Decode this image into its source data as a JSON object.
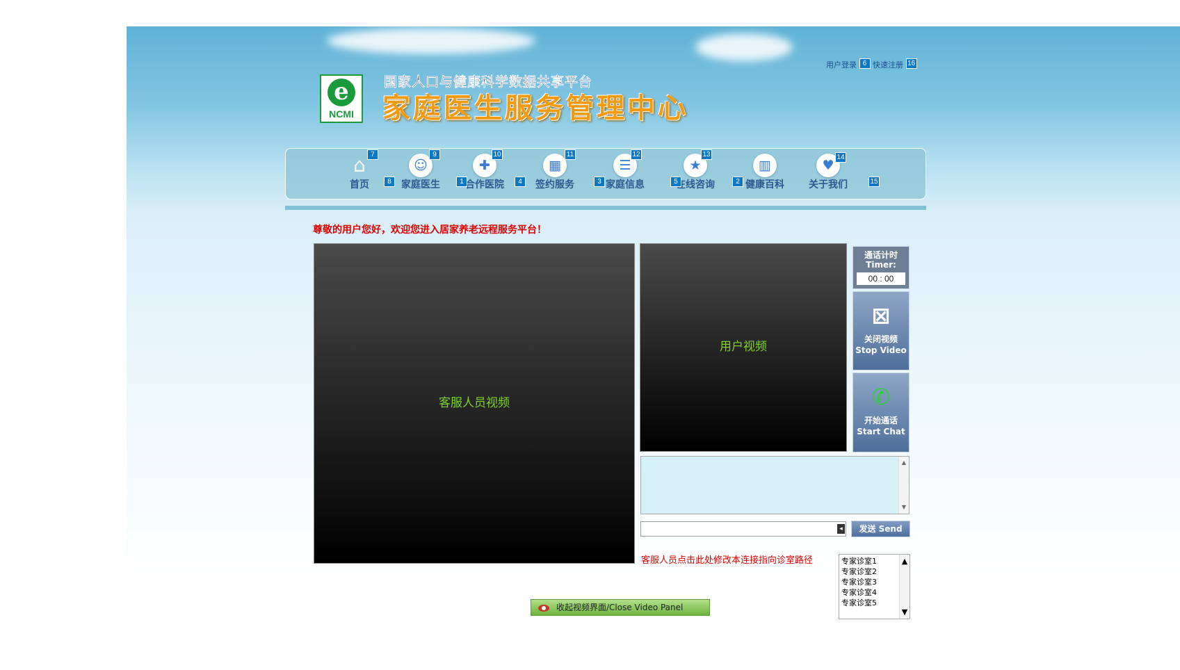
{
  "header": {
    "logo_text": "NCMI",
    "subtitle": "国家人口与健康科学数据共享平台",
    "title": "家庭医生服务管理中心",
    "login_link": "用户登录",
    "login_badge": "6",
    "register_link": "快速注册",
    "register_badge": "16"
  },
  "nav": {
    "items": [
      {
        "label": "首页",
        "icon": "home-icon",
        "badge": "7"
      },
      {
        "label": "家庭医生",
        "icon": "doctor-icon",
        "badge": "9"
      },
      {
        "label": "合作医院",
        "icon": "hospital-icon",
        "badge": "10"
      },
      {
        "label": "签约服务",
        "icon": "calendar-icon",
        "badge": "11"
      },
      {
        "label": "家庭信息",
        "icon": "family-info-icon",
        "badge": "12"
      },
      {
        "label": "在线咨询",
        "icon": "star-hand-icon",
        "badge": "13"
      },
      {
        "label": "健康百科",
        "icon": "book-icon",
        "badge": "2"
      },
      {
        "label": "关于我们",
        "icon": "handshake-icon",
        "badge": "14"
      }
    ],
    "inline_badges": [
      "8",
      "1",
      "4",
      "3",
      "5",
      "15"
    ]
  },
  "greeting": "尊敬的用户您好，欢迎您进入居家养老远程服务平台！",
  "videos": {
    "staff_label": "客服人员视频",
    "user_label": "用户视频"
  },
  "timer": {
    "label_cn": "通话计时",
    "label_en": "Timer:",
    "value": "00 : 00"
  },
  "controls": {
    "stop_video_cn": "关闭视频",
    "stop_video_en": "Stop Video",
    "start_chat_cn": "开始通话",
    "start_chat_en": "Start Chat",
    "send_label": "发送  Send"
  },
  "chat": {
    "input_value": ""
  },
  "rooms": {
    "link_text": "客服人员点击此处修改本连接指向诊室路径",
    "options": [
      "专家诊室1",
      "专家诊室2",
      "专家诊室3",
      "专家诊室4",
      "专家诊室5"
    ]
  },
  "footer": {
    "close_panel_label": "收起视频界面/Close  Video  Panel"
  },
  "colors": {
    "accent_blue": "#0b77c7",
    "video_text": "#7ed321",
    "alert_red": "#e00000"
  }
}
